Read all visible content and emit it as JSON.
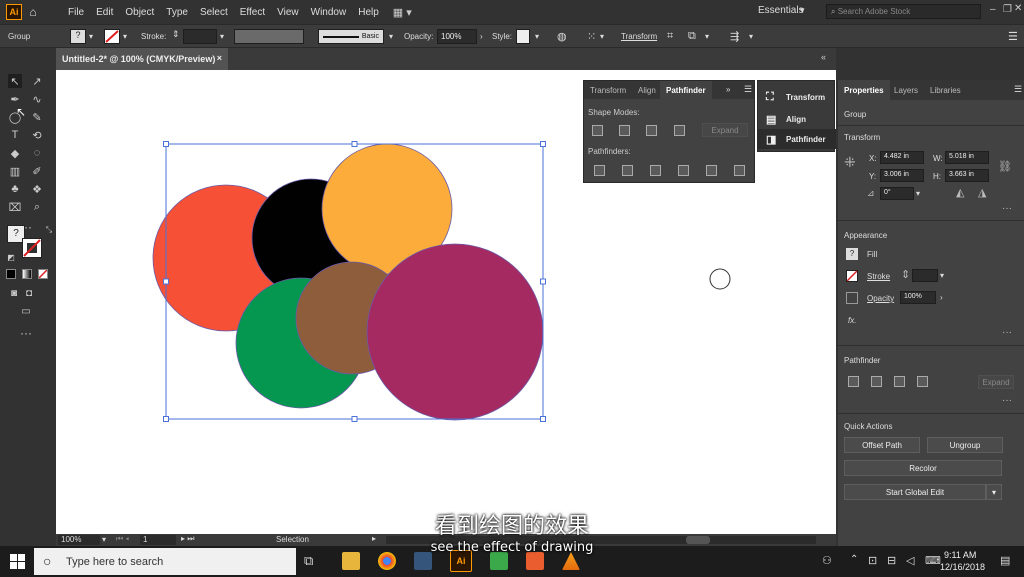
{
  "app": {
    "logo": "Ai"
  },
  "menu": [
    "File",
    "Edit",
    "Object",
    "Type",
    "Select",
    "Effect",
    "View",
    "Window",
    "Help"
  ],
  "workspace": {
    "label": "Essentials",
    "search_placeholder": "Search Adobe Stock"
  },
  "control_bar": {
    "selection": "Group",
    "fill_value": "?",
    "stroke_label": "Stroke:",
    "brush_label": "Basic",
    "opacity_label": "Opacity:",
    "opacity_value": "100%",
    "style_label": "Style:",
    "transform_label": "Transform"
  },
  "document_tab": {
    "title": "Untitled-2* @ 100% (CMYK/Preview)",
    "close": "×"
  },
  "status_bar": {
    "zoom": "100%",
    "artboard": "1",
    "tool": "Selection"
  },
  "float_panel": {
    "tabs": [
      "Transform",
      "Align",
      "Pathfinder"
    ],
    "active_tab": "Pathfinder",
    "shape_modes_label": "Shape Modes:",
    "expand_label": "Expand",
    "pathfinders_label": "Pathfinders:"
  },
  "dock": {
    "items": [
      "Transform",
      "Align",
      "Pathfinder"
    ]
  },
  "properties": {
    "tabs": [
      "Properties",
      "Layers",
      "Libraries"
    ],
    "active_tab": "Properties",
    "object_type": "Group",
    "transform_title": "Transform",
    "x_label": "X:",
    "x": "4.482 in",
    "y_label": "Y:",
    "y": "3.006 in",
    "w_label": "W:",
    "w": "5.018 in",
    "h_label": "H:",
    "h": "3.663 in",
    "angle": "0°",
    "appearance_title": "Appearance",
    "fill_label": "Fill",
    "stroke_label": "Stroke",
    "opacity_label": "Opacity",
    "opacity_value": "100%",
    "fx_label": "fx.",
    "pathfinder_title": "Pathfinder",
    "pathfinder_expand": "Expand",
    "quick_actions_title": "Quick Actions",
    "offset_path": "Offset Path",
    "ungroup": "Ungroup",
    "recolor": "Recolor",
    "start_global_edit": "Start Global Edit"
  },
  "artwork": {
    "colors": {
      "red": "#f65137",
      "black": "#020102",
      "orange": "#fbac3b",
      "green": "#05964f",
      "brown": "#8d5d3c",
      "magenta": "#a62a62",
      "selection": "#4a72d8"
    }
  },
  "taskbar": {
    "search_placeholder": "Type here to search",
    "time": "9:11 AM",
    "date": "12/16/2018"
  },
  "subtitles": {
    "chinese": "看到绘图的效果",
    "english": "see the effect of drawing"
  }
}
